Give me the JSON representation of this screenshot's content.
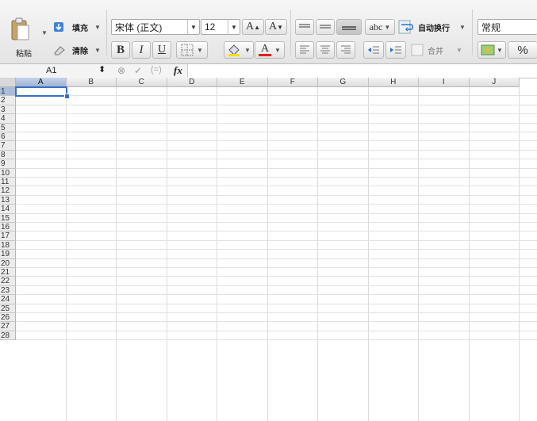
{
  "toolbar": {
    "paste_label": "粘贴",
    "fill_label": "填充",
    "clear_label": "清除",
    "font_name": "宋体 (正文)",
    "font_size": "12",
    "grow_font_label": "A",
    "shrink_font_label": "A",
    "bold_label": "B",
    "italic_label": "I",
    "underline_label": "U",
    "font_color_label": "A",
    "orientation_label": "abc",
    "wrap_text_label": "自动换行",
    "merge_label": "合并",
    "number_format": "常规",
    "percent_label": "%",
    "font_color_hex": "#e02020",
    "fill_color_hex": "#f2e200"
  },
  "formula_bar": {
    "name_box": "A1",
    "fx_label": "fx"
  },
  "sheet": {
    "columns": [
      "A",
      "B",
      "C",
      "D",
      "E",
      "F",
      "G",
      "H",
      "I",
      "J"
    ],
    "rows": [
      "1",
      "2",
      "3",
      "4",
      "5",
      "6",
      "7",
      "8",
      "9",
      "10",
      "11",
      "12",
      "13",
      "14",
      "15",
      "16",
      "17",
      "18",
      "19",
      "20",
      "21",
      "22",
      "23",
      "24",
      "25",
      "26",
      "27",
      "28"
    ],
    "selected_cell": "A1",
    "selection_color": "#3a6fc4"
  }
}
